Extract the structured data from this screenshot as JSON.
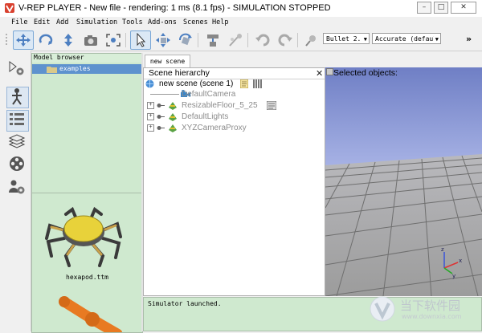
{
  "window": {
    "title": "V-REP PLAYER - New file - rendering: 1 ms (8.1 fps) - SIMULATION STOPPED"
  },
  "menu": [
    "File",
    "Edit",
    "Add",
    "Simulation",
    "Tools",
    "Add-ons",
    "Scenes",
    "Help"
  ],
  "toolbar": {
    "engine_value": "Bullet 2.",
    "accuracy_value": "Accurate (defaul",
    "more": "»"
  },
  "model_browser": {
    "header": "Model browser",
    "selected_folder": "examples",
    "thumbnail_caption": "hexapod.ttm"
  },
  "scene_tab": "new scene",
  "hierarchy": {
    "title": "Scene hierarchy",
    "close": "✕",
    "root": "new scene (scene 1)",
    "items": [
      {
        "label": "DefaultCamera"
      },
      {
        "label": "ResizableFloor_5_25"
      },
      {
        "label": "DefaultLights"
      },
      {
        "label": "XYZCameraProxy"
      }
    ]
  },
  "view": {
    "selected_objects_label": "Selected objects:"
  },
  "status": {
    "message": "Simulator launched."
  },
  "watermark": {
    "brand": "当下软件园",
    "url": "www.downxia.com"
  },
  "colors": {
    "panel_green": "#cfe9cf",
    "selection_blue": "#5e92ce",
    "sky_top": "#6f7fc5",
    "floor": "#9a9a9a",
    "dim_text": "#8c8c8c"
  }
}
